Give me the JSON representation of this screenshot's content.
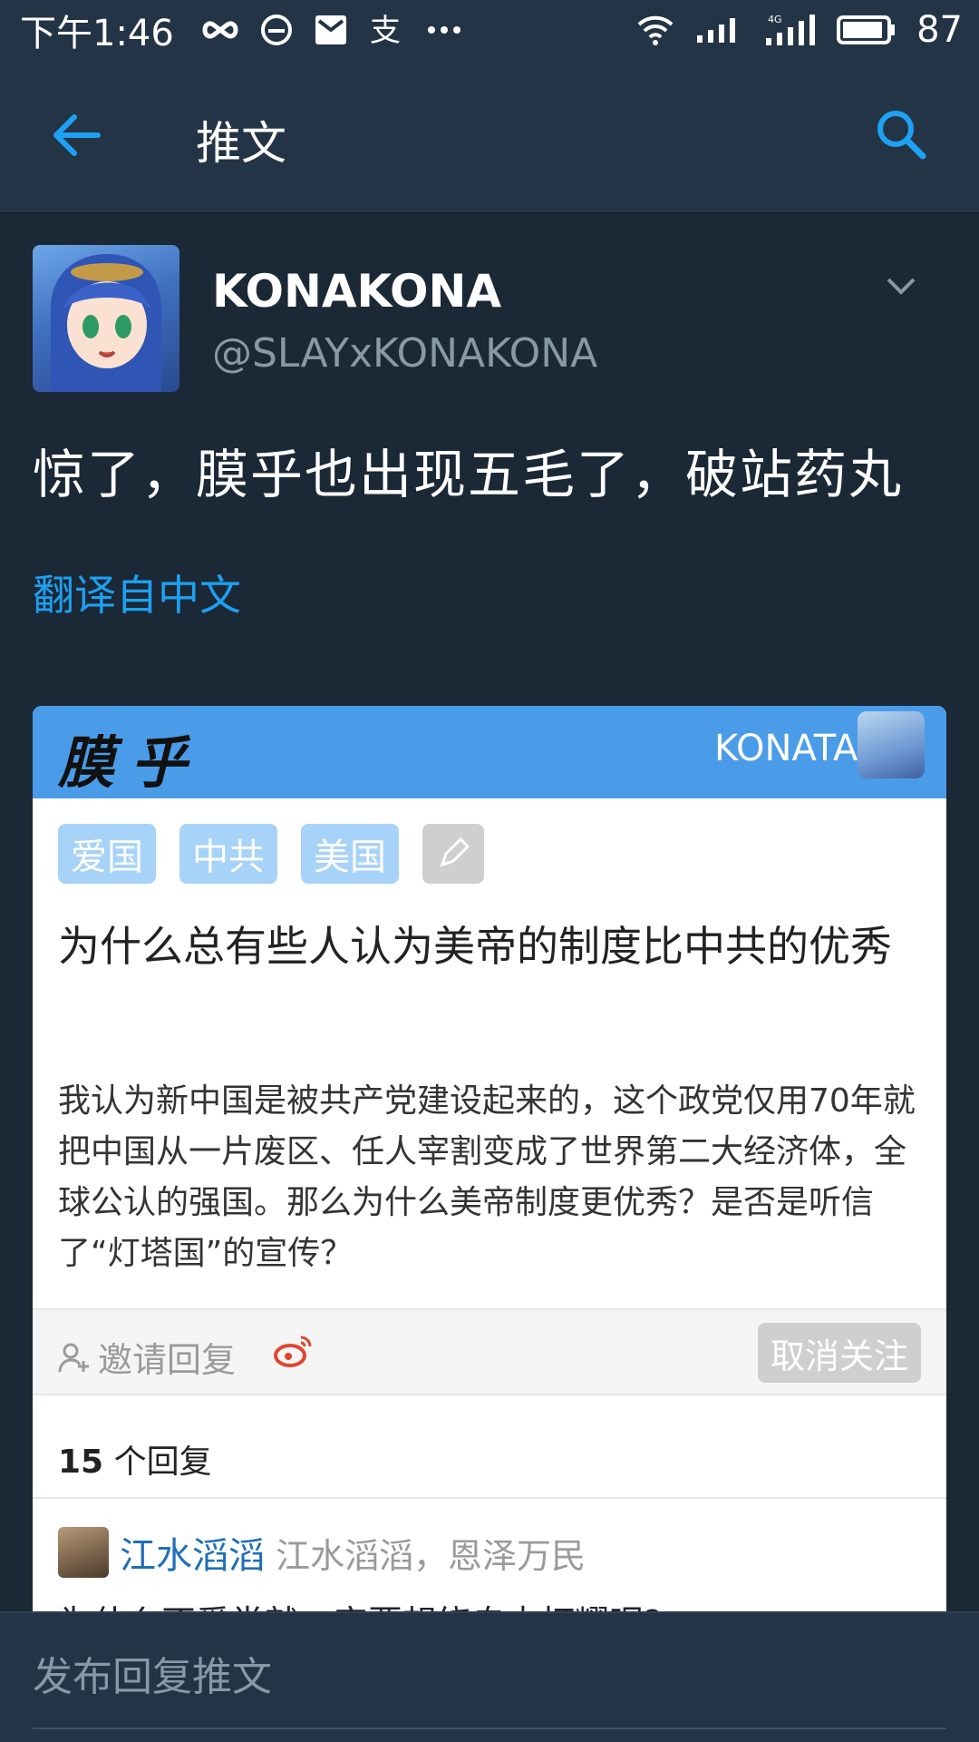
{
  "status_bar": {
    "time": "下午1:46",
    "network_label": "4G",
    "battery": "87"
  },
  "app_bar": {
    "title": "推文"
  },
  "tweet": {
    "author_name": "KONAKONA",
    "author_handle": "@SLAYxKONAKONA",
    "text": "惊了，膜乎也出现五毛了，破站药丸",
    "translate_label": "翻译自中文"
  },
  "embedded_image": {
    "site_logo": "膜乎",
    "username": "KONATA",
    "tags": [
      "爱国",
      "中共",
      "美国"
    ],
    "question_title": "为什么总有些人认为美帝的制度比中共的优秀",
    "question_body": "我认为新中国是被共产党建设起来的，这个政党仅用70年就把中国从一片废区、任人宰割变成了世界第二大经济体，全球公认的强国。那么为什么美帝制度更优秀？是否是听信了“灯塔国”的宣传？",
    "invite_label": "邀请回复",
    "unfollow_label": "取消关注",
    "reply_count_num": "15",
    "reply_count_label": "个回复",
    "first_reply": {
      "name": "江水滔滔",
      "bio": "江水滔滔，恩泽万民",
      "text_cut": "为什么不爱党就一定要想绕自由打耀呢?"
    }
  },
  "reply_bar": {
    "placeholder": "发布回复推文"
  },
  "colors": {
    "background": "#1b2836",
    "bar": "#243447",
    "accent": "#1da1f2",
    "muted_text": "#8899a6",
    "card_header": "#4a9ce8",
    "tag_bg": "#a7d3f8"
  }
}
